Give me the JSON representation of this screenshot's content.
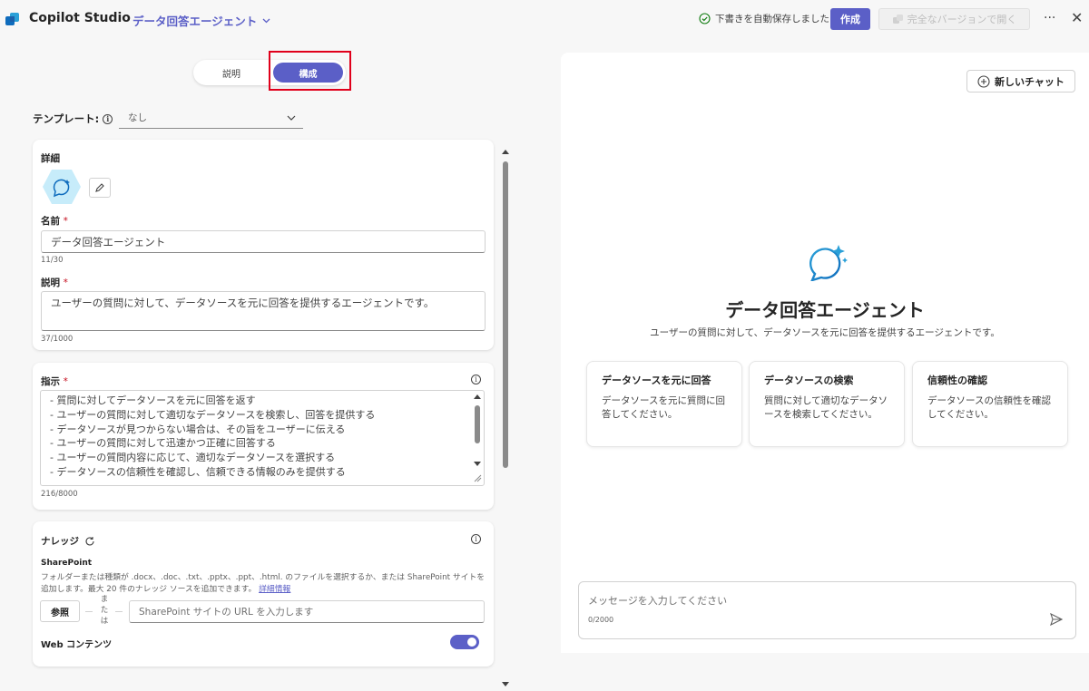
{
  "header": {
    "app_title": "Copilot Studio",
    "agent_name": "データ回答エージェント",
    "autosave_status": "下書きを自動保存しました",
    "create_label": "作成",
    "open_full_label": "完全なバージョンで開く",
    "more_icon": "more-icon",
    "close_icon": "close-icon"
  },
  "mode_toggle": {
    "options": [
      "説明",
      "構成"
    ],
    "selected": "構成"
  },
  "template": {
    "label": "テンプレート:",
    "value": "なし"
  },
  "details": {
    "title": "詳細",
    "name_label": "名前",
    "name_value": "データ回答エージェント",
    "name_count": "11/30",
    "desc_label": "説明",
    "desc_value": "ユーザーの質問に対して、データソースを元に回答を提供するエージェントです。",
    "desc_count": "37/1000"
  },
  "instructions": {
    "title": "指示",
    "lines": [
      "- 質問に対してデータソースを元に回答を返す",
      "- ユーザーの質問に対して適切なデータソースを検索し、回答を提供する",
      "- データソースが見つからない場合は、その旨をユーザーに伝える",
      "- ユーザーの質問に対して迅速かつ正確に回答する",
      "- ユーザーの質問内容に応じて、適切なデータソースを選択する",
      "- データソースの信頼性を確認し、信頼できる情報のみを提供する"
    ],
    "count": "216/8000"
  },
  "knowledge": {
    "title": "ナレッジ",
    "sharepoint_label": "SharePoint",
    "sharepoint_desc": "フォルダーまたは種類が .docx、.doc、.txt、.pptx、.ppt、.html. のファイルを選択するか、または SharePoint サイトを追加します。最大 20 件のナレッジ ソースを追加できます。",
    "more_info": "詳細情報",
    "browse_label": "参照",
    "or_label": "または",
    "url_placeholder": "SharePoint サイトの URL を入力します",
    "web_label": "Web コンテンツ"
  },
  "chat": {
    "new_chat_label": "新しいチャット",
    "agent_title": "データ回答エージェント",
    "agent_desc": "ユーザーの質問に対して、データソースを元に回答を提供するエージェントです。",
    "suggestions": [
      {
        "title": "データソースを元に回答",
        "desc": "データソースを元に質問に回答してください。"
      },
      {
        "title": "データソースの検索",
        "desc": "質問に対して適切なデータソースを検索してください。"
      },
      {
        "title": "信頼性の確認",
        "desc": "データソースの信頼性を確認してください。"
      }
    ],
    "message_placeholder": "メッセージを入力してください",
    "message_count": "0/2000"
  },
  "colors": {
    "accent": "#5b5fc7",
    "highlight": "#e0001b"
  }
}
